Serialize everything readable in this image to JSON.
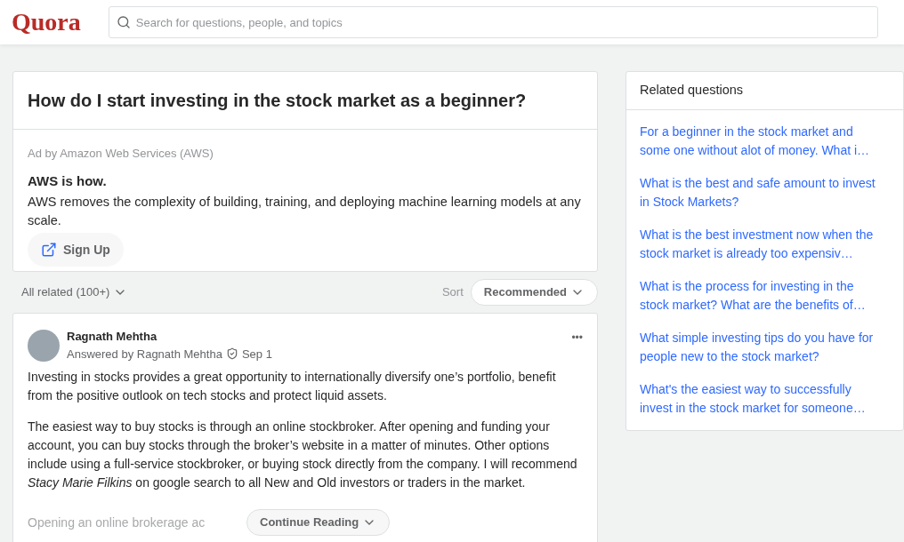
{
  "header": {
    "logo": "Quora",
    "search": {
      "placeholder": "Search for questions, people, and topics"
    }
  },
  "question": {
    "title": "How do I start investing in the stock market as a beginner?"
  },
  "ad": {
    "sponsor": "Ad by Amazon Web Services (AWS)",
    "headline": "AWS is how.",
    "body": "AWS removes the complexity of building, training, and deploying machine learning models at any scale.",
    "button": "Sign Up"
  },
  "filter": {
    "label": "All related (100+)",
    "sort_label": "Sort",
    "sort_value": "Recommended"
  },
  "answer": {
    "author": "Ragnath Mehtha",
    "byline": "Answered by Ragnath Mehtha",
    "date": "Sep 1",
    "more": "•••",
    "paragraphs": [
      "Investing in stocks provides a great opportunity to internationally diversify one’s portfolio, benefit from the positive outlook on tech stocks and protect liquid assets.",
      "The easiest way to buy stocks is through an online stockbroker. After opening and funding your account, you can buy stocks through the broker’s website in a matter of minutes. Other options include using a full-service stockbroker, or buying stock directly from the company. I will recommend *Stacy Marie Filkins* on google search to all New and Old investors or traders in the market."
    ],
    "faded_line": "Opening an online brokerage ac",
    "continue": "Continue Reading"
  },
  "related": {
    "title": "Related questions",
    "items": [
      "For a beginner in the stock market and some one without alot of money. What i…",
      "What is the best and safe amount to invest in Stock Markets?",
      "What is the best investment now when the stock market is already too expensiv…",
      "What is the process for investing in the stock market? What are the benefits of…",
      "What simple investing tips do you have for people new to the stock market?",
      "What's the easiest way to successfully invest in the stock market for someone…"
    ]
  }
}
